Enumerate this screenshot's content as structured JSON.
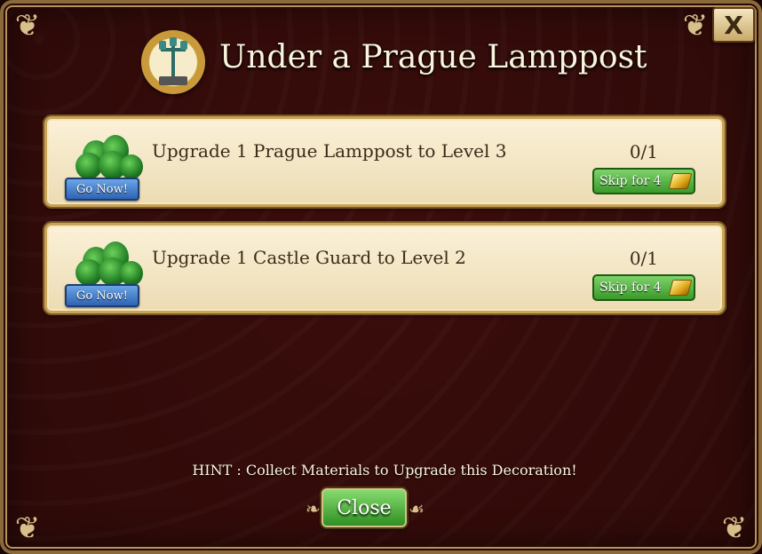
{
  "dialog": {
    "title": "Under a Prague Lamppost",
    "close_icon_label": "X",
    "icon_name": "prague-lamppost-medallion"
  },
  "quests": [
    {
      "description": "Upgrade 1 Prague Lamppost to Level 3",
      "progress": "0/1",
      "go_label": "Go Now!",
      "skip_label": "Skip for 4",
      "icon_name": "tree-bushes-icon"
    },
    {
      "description": "Upgrade 1 Castle Guard to Level 2",
      "progress": "0/1",
      "go_label": "Go Now!",
      "skip_label": "Skip for 4",
      "icon_name": "tree-bushes-icon"
    }
  ],
  "hint": "HINT : Collect Materials to Upgrade this Decoration!",
  "close_label": "Close",
  "colors": {
    "background": "#3b0d0b",
    "panel": "#fbf1d8",
    "go_button": "#2f63b3",
    "skip_button": "#3a9a2a",
    "close_button": "#2f8f22",
    "title_text": "#fbf3dc"
  }
}
